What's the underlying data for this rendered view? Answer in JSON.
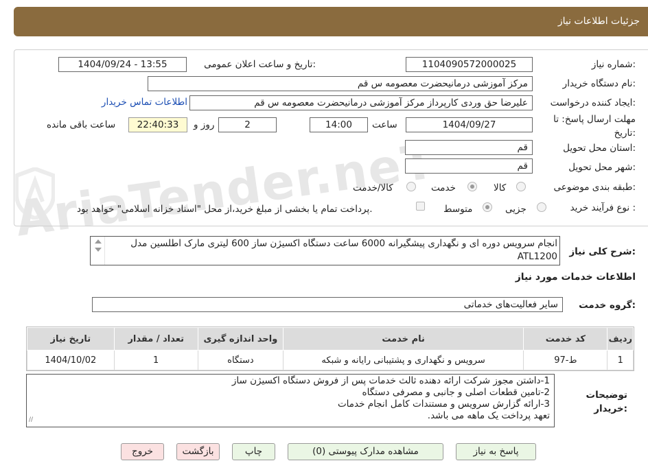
{
  "header": {
    "title": "جزئیات اطلاعات نیاز"
  },
  "form": {
    "need_number_label": "شماره نیاز:",
    "need_number": "1104090572000025",
    "announce_label": "تاریخ و ساعت اعلان عمومی:",
    "announce_value": "1404/09/24 - 13:55",
    "buyer_org_label": "نام دستگاه خریدار:",
    "buyer_org": "مرکز آموزشی درمانیحضرت معصومه س  قم",
    "creator_label": "ایجاد کننده درخواست:",
    "creator": "علیرضا حق وردی کارپرداز مرکز آموزشی درمانیحضرت معصومه س  قم",
    "contact_link": "اطلاعات تماس خریدار",
    "deadline_label": "مهلت ارسال پاسخ: تا تاریخ:",
    "deadline_date": "1404/09/27",
    "time_label": "ساعت",
    "deadline_time": "14:00",
    "days_value": "2",
    "days_label": "روز و",
    "remaining_time": "22:40:33",
    "remaining_label": "ساعت باقی مانده",
    "province_label": "استان محل تحویل:",
    "province": "قم",
    "city_label": "شهر محل تحویل:",
    "city": "قم",
    "category_label": "طبقه بندی موضوعی:",
    "category_options": [
      "کالا",
      "خدمت",
      "کالا/خدمت"
    ],
    "category_selected": "خدمت",
    "process_label": "نوع فرآیند خرید :",
    "process_options": [
      "جزیی",
      "متوسط"
    ],
    "process_selected": "جزیی",
    "payment_note": "پرداخت تمام یا بخشی از مبلغ خرید،از محل \"اسناد خزانه اسلامی\" خواهد بود."
  },
  "description": {
    "label": "شرح کلی نیاز:",
    "text": "انجام سرویس دوره ای و نگهداری پیشگیرانه 6000 ساعت دستگاه اکسیژن ساز 600 لیتری مارک اطلسین مدل ATL1200"
  },
  "services": {
    "section_title": "اطلاعات خدمات مورد نیاز",
    "group_label": "گروه خدمت:",
    "group_value": "سایر فعالیت‌های خدماتی",
    "columns": [
      "ردیف",
      "کد خدمت",
      "نام خدمت",
      "واحد اندازه گیری",
      "تعداد / مقدار",
      "تاریخ نیاز"
    ],
    "rows": [
      [
        "1",
        "ط-97",
        "سرویس و نگهداری و پشتیبانی رایانه و شبکه",
        "دستگاه",
        "1",
        "1404/10/02"
      ]
    ]
  },
  "buyer_notes": {
    "label": "توضیحات خریدار:",
    "lines": [
      "1-داشتن مجوز شرکت ارائه دهنده ثالث خدمات پس از فروش دستگاه اکسیژن ساز",
      "2-تامین قطعات اصلی و جانبی و مصرفی دستگاه",
      "3-ارائه گزارش سرویس و مستندات کامل انجام خدمات",
      "تعهد پرداخت یک ماهه می باشد."
    ]
  },
  "buttons": {
    "respond": "پاسخ به نیاز",
    "view_docs": "مشاهده مدارک پیوستی (0)",
    "print": "چاپ",
    "back": "بازگشت",
    "exit": "خروج"
  },
  "watermark": {
    "text": "AriaTender.neT"
  },
  "colors": {
    "header_bg": "#8a6b3e",
    "timer_bg": "#fffbd2",
    "link": "#1a4db3",
    "green_btn": "#eaf6e4",
    "pink_btn": "#fbe1e1"
  }
}
